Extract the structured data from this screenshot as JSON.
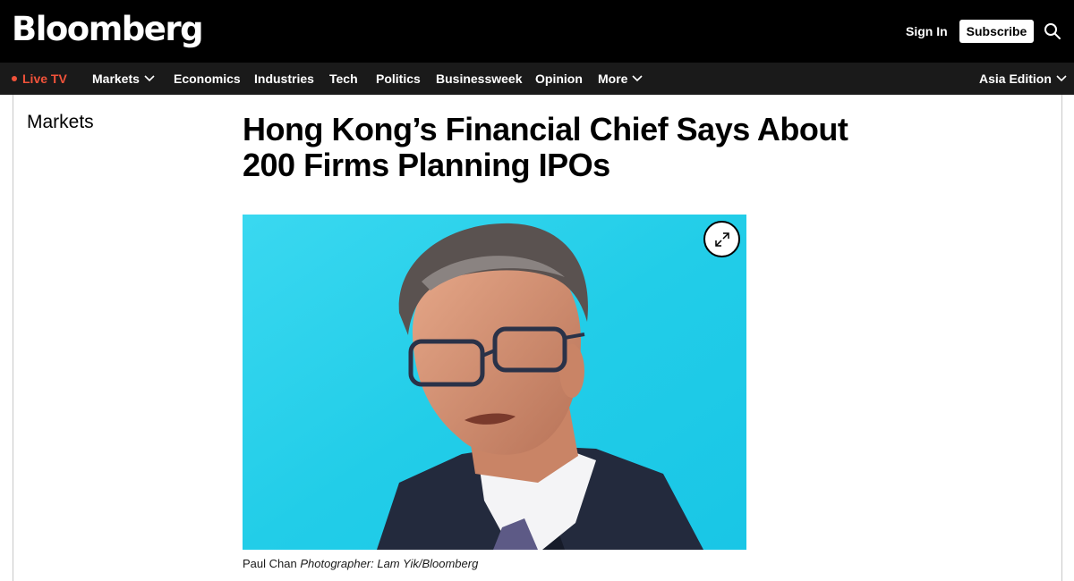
{
  "header": {
    "logo": "Bloomberg",
    "sign_in": "Sign In",
    "subscribe": "Subscribe",
    "search_icon": "search-icon"
  },
  "nav": {
    "live_tv": "Live TV",
    "markets": "Markets",
    "economics": "Economics",
    "industries": "Industries",
    "tech": "Tech",
    "politics": "Politics",
    "businessweek": "Businessweek",
    "opinion": "Opinion",
    "more": "More",
    "edition": "Asia Edition"
  },
  "article": {
    "section": "Markets",
    "headline": "Hong Kong’s Financial Chief Says About 200 Firms Planning IPOs",
    "image_caption": "Paul Chan",
    "image_credit": "Photographer: Lam Yik/Bloomberg",
    "expand_icon": "expand-icon"
  },
  "colors": {
    "top_bar": "#000000",
    "nav_bar": "#1a1a1a",
    "live_accent": "#f0523a",
    "photo_background": "#2ad4ec"
  }
}
